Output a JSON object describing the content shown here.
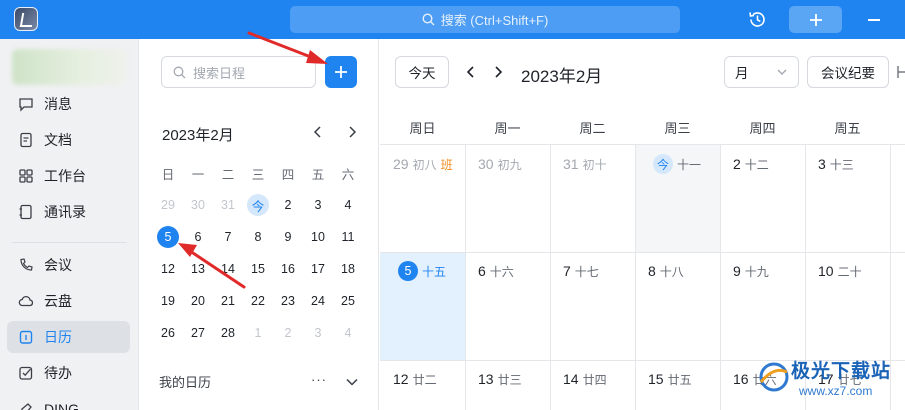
{
  "topbar": {
    "search_placeholder": "搜索 (Ctrl+Shift+F)",
    "accent": "#1f84f0"
  },
  "nav": {
    "items": [
      {
        "label": "消息",
        "icon": "message-icon"
      },
      {
        "label": "文档",
        "icon": "document-icon"
      },
      {
        "label": "工作台",
        "icon": "workbench-icon"
      },
      {
        "label": "通讯录",
        "icon": "contacts-icon"
      },
      {
        "label": "会议",
        "icon": "meeting-icon"
      },
      {
        "label": "云盘",
        "icon": "cloud-icon"
      },
      {
        "label": "日历",
        "icon": "calendar-icon",
        "active": true
      },
      {
        "label": "待办",
        "icon": "todo-icon"
      },
      {
        "label": "DING",
        "icon": "ding-icon"
      }
    ]
  },
  "mini": {
    "search_placeholder": "搜索日程",
    "month_title": "2023年2月",
    "weekdays": [
      "日",
      "一",
      "二",
      "三",
      "四",
      "五",
      "六"
    ],
    "rows": [
      [
        {
          "t": "29",
          "dim": true
        },
        {
          "t": "30",
          "dim": true
        },
        {
          "t": "31",
          "dim": true
        },
        {
          "t": "今",
          "today": true
        },
        {
          "t": "2"
        },
        {
          "t": "3"
        },
        {
          "t": "4"
        }
      ],
      [
        {
          "t": "5",
          "sel": true
        },
        {
          "t": "6"
        },
        {
          "t": "7"
        },
        {
          "t": "8"
        },
        {
          "t": "9"
        },
        {
          "t": "10"
        },
        {
          "t": "11"
        }
      ],
      [
        {
          "t": "12"
        },
        {
          "t": "13"
        },
        {
          "t": "14"
        },
        {
          "t": "15"
        },
        {
          "t": "16"
        },
        {
          "t": "17"
        },
        {
          "t": "18"
        }
      ],
      [
        {
          "t": "19"
        },
        {
          "t": "20"
        },
        {
          "t": "21"
        },
        {
          "t": "22"
        },
        {
          "t": "23"
        },
        {
          "t": "24"
        },
        {
          "t": "25"
        }
      ],
      [
        {
          "t": "26"
        },
        {
          "t": "27"
        },
        {
          "t": "28"
        },
        {
          "t": "1",
          "dim": true
        },
        {
          "t": "2",
          "dim": true
        },
        {
          "t": "3",
          "dim": true
        },
        {
          "t": "4",
          "dim": true
        }
      ]
    ],
    "my_calendars_label": "我的日历",
    "more_label": "···"
  },
  "main": {
    "today_button": "今天",
    "title": "2023年2月",
    "view_value": "月",
    "minutes_button": "会议纪要",
    "weekdays": [
      "周日",
      "周一",
      "周二",
      "周三",
      "周四",
      "周五"
    ],
    "weeks": [
      [
        {
          "num": "29",
          "lunar": "初八",
          "tag": "班",
          "dim": true
        },
        {
          "num": "30",
          "lunar": "初九",
          "dim": true
        },
        {
          "num": "31",
          "lunar": "初十",
          "dim": true
        },
        {
          "num": "今",
          "lunar": "十一",
          "today": true
        },
        {
          "num": "2",
          "lunar": "十二"
        },
        {
          "num": "3",
          "lunar": "十三"
        }
      ],
      [
        {
          "num": "5",
          "lunar": "十五",
          "sel": true
        },
        {
          "num": "6",
          "lunar": "十六"
        },
        {
          "num": "7",
          "lunar": "十七"
        },
        {
          "num": "8",
          "lunar": "十八"
        },
        {
          "num": "9",
          "lunar": "十九"
        },
        {
          "num": "10",
          "lunar": "二十"
        }
      ],
      [
        {
          "num": "12",
          "lunar": "廿二"
        },
        {
          "num": "13",
          "lunar": "廿三"
        },
        {
          "num": "14",
          "lunar": "廿四"
        },
        {
          "num": "15",
          "lunar": "廿五"
        },
        {
          "num": "16",
          "lunar": "廿六"
        },
        {
          "num": "17",
          "lunar": "廿七"
        }
      ]
    ]
  },
  "watermark": {
    "title": "极光下载站",
    "url": "www.xz7.com"
  }
}
